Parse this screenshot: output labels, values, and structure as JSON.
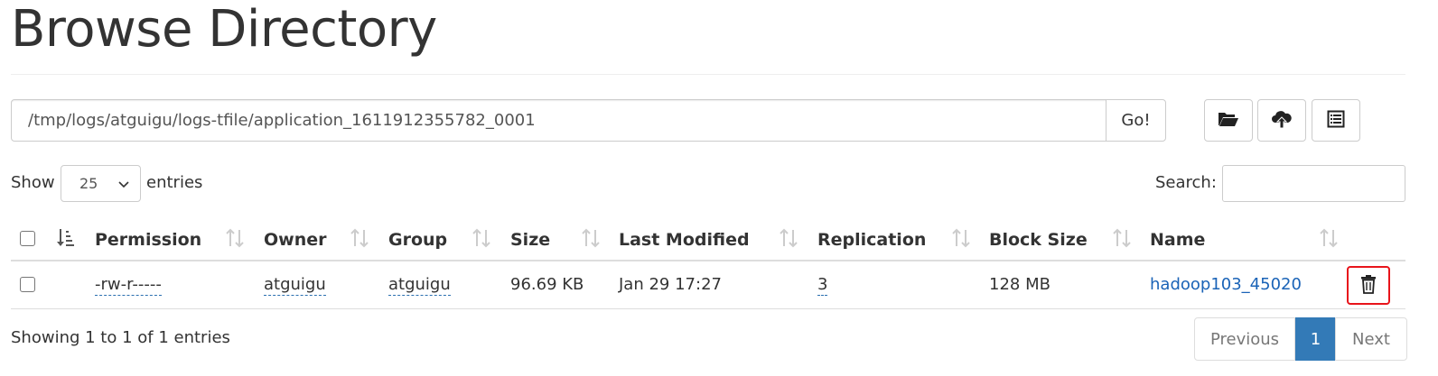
{
  "page": {
    "title": "Browse Directory"
  },
  "path_bar": {
    "path_value": "/tmp/logs/atguigu/logs-tfile/application_1611912355782_0001",
    "go_label": "Go!"
  },
  "toolbar": {
    "icons": [
      "folder-open-icon",
      "cloud-upload-icon",
      "list-alt-icon"
    ]
  },
  "length_menu": {
    "show_label": "Show",
    "selected": "25",
    "entries_label": "entries"
  },
  "search": {
    "label": "Search:",
    "value": ""
  },
  "table": {
    "columns": [
      "Permission",
      "Owner",
      "Group",
      "Size",
      "Last Modified",
      "Replication",
      "Block Size",
      "Name"
    ],
    "rows": [
      {
        "permission": "-rw-r-----",
        "owner": "atguigu",
        "group": "atguigu",
        "size": "96.69 KB",
        "last_modified": "Jan 29 17:27",
        "replication": "3",
        "block_size": "128 MB",
        "name": "hadoop103_45020"
      }
    ]
  },
  "footer": {
    "info": "Showing 1 to 1 of 1 entries",
    "pagination": {
      "previous": "Previous",
      "current": "1",
      "next": "Next"
    }
  },
  "colors": {
    "link": "#1a63b7",
    "pagination_active": "#337ab7",
    "highlight_border": "#e8141b"
  }
}
